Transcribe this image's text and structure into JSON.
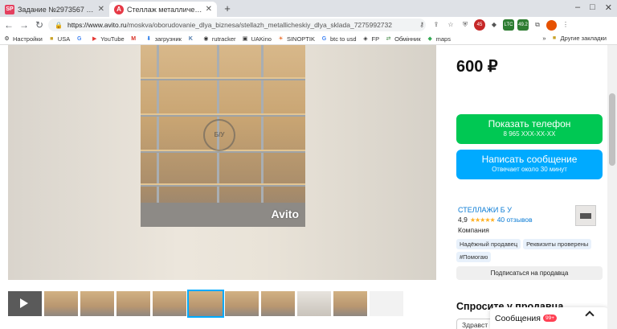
{
  "browser": {
    "tabs": [
      {
        "favicon": "SP",
        "title": "Задание №2973567 - просмотр з",
        "close": "✕",
        "active": false
      },
      {
        "favicon": "A",
        "title": "Стеллаж металлический для скл",
        "close": "✕",
        "active": true
      }
    ],
    "new_tab": "+",
    "url": {
      "host": "https://www.avito.ru",
      "path": "/moskva/oborudovanie_dlya_biznesa/stellazh_metallicheskiy_dlya_sklada_7275992732"
    },
    "extension_badges": {
      "ltc": "LTC",
      "ltc_value": "49.2",
      "red": "45"
    },
    "bookmarks": [
      "Настройки",
      "USA",
      "YouTube",
      "загрузник",
      "rutracker",
      "UAKino",
      "SINOPTIK",
      "btc to usd",
      "FP",
      "Обмінник",
      "maps"
    ],
    "bookmarks_more": "»",
    "bookmarks_other": "Другие закладки"
  },
  "listing": {
    "watermark_stamp": "Б/У",
    "watermark_brand": "Avito",
    "thumbnail_count": 11,
    "selected_thumbnail": 5,
    "price": "600 ₽",
    "phone_button": {
      "label": "Показать телефон",
      "sub": "8 965 XXX-XX-XX"
    },
    "message_button": {
      "label": "Написать сообщение",
      "sub": "Отвечает около 30 минут"
    },
    "seller": {
      "name": "СТЕЛЛАЖИ Б У",
      "rating": "4,9",
      "stars": "★★★★★",
      "reviews": "40 отзывов",
      "type": "Компания"
    },
    "badges": [
      "Надёжный продавец",
      "Реквизиты проверены",
      "#Помогаю"
    ],
    "subscribe": "Подписаться на продавца",
    "ask_title": "Спросите у продавца",
    "ask_input_value": "Здравст"
  },
  "messages_widget": {
    "label": "Сообщения",
    "count": "99+"
  },
  "colors": {
    "green": "#00c853",
    "blue": "#00aaff",
    "link": "#0a7bd5",
    "badge_red": "#ff4053"
  }
}
